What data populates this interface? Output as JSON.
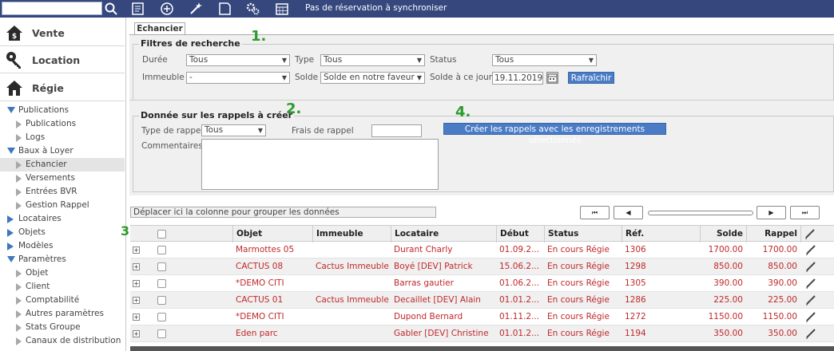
{
  "topbar": {
    "status_text": "Pas de réservation à synchroniser",
    "icons": [
      "search-icon",
      "list-icon",
      "plus-circle-icon",
      "magic-wand-icon",
      "note-icon",
      "gears-icon",
      "calendar-icon"
    ]
  },
  "sidebar": {
    "big_items": [
      {
        "label": "Vente",
        "icon": "house-dollar-icon"
      },
      {
        "label": "Location",
        "icon": "key-icon"
      },
      {
        "label": "Régie",
        "icon": "house-icon"
      }
    ],
    "tree": [
      {
        "label": "Publications",
        "level": 0,
        "expanded": true
      },
      {
        "label": "Publications",
        "level": 1
      },
      {
        "label": "Logs",
        "level": 1
      },
      {
        "label": "Baux à Loyer",
        "level": 0,
        "expanded": true
      },
      {
        "label": "Echancier",
        "level": 1,
        "selected": true
      },
      {
        "label": "Versements",
        "level": 1
      },
      {
        "label": "Entrées BVR",
        "level": 1
      },
      {
        "label": "Gestion Rappel",
        "level": 1
      },
      {
        "label": "Locataires",
        "level": 0,
        "expanded": false
      },
      {
        "label": "Objets",
        "level": 0,
        "expanded": false
      },
      {
        "label": "Modèles",
        "level": 0,
        "expanded": false
      },
      {
        "label": "Paramètres",
        "level": 0,
        "expanded": true
      },
      {
        "label": "Objet",
        "level": 1
      },
      {
        "label": "Client",
        "level": 1
      },
      {
        "label": "Comptabilité",
        "level": 1
      },
      {
        "label": "Autres paramètres",
        "level": 1
      },
      {
        "label": "Stats Groupe",
        "level": 1
      },
      {
        "label": "Canaux de distribution",
        "level": 1
      }
    ]
  },
  "tab": {
    "label": "Echancier"
  },
  "filters": {
    "legend": "Filtres de recherche",
    "marker": "1.",
    "duree_label": "Durée",
    "duree_value": "Tous",
    "type_label": "Type",
    "type_value": "Tous",
    "status_label": "Status",
    "status_value": "Tous",
    "immeuble_label": "Immeuble",
    "immeuble_value": "-",
    "solde_label": "Solde",
    "solde_value": "Solde en notre faveur",
    "solde_date_label": "Solde à ce jour",
    "solde_date_value": "19.11.2019",
    "refresh_label": "Rafraîchir"
  },
  "reminders": {
    "legend": "Donnée sur les rappels à créer",
    "marker": "2.",
    "type_label": "Type de rappel",
    "type_value": "Tous",
    "frais_label": "Frais de rappel",
    "frais_value": "",
    "comments_label": "Commentaires",
    "comments_value": "",
    "create_marker": "4.",
    "create_label": "Créer les rappels avec les enregistrements sélectionnés"
  },
  "grid": {
    "marker": "3.",
    "group_hint": "Déplacer ici la colonne pour grouper les données",
    "pager": {
      "first": "⏮",
      "prev": "◀",
      "next": "▶",
      "last": "⏭"
    },
    "columns": [
      "Objet",
      "Immeuble",
      "Locataire",
      "Début",
      "Status",
      "Réf.",
      "Solde",
      "Rappel"
    ],
    "rows": [
      {
        "objet": "Marmottes 05",
        "immeuble": "",
        "locataire": "Durant Charly",
        "debut": "01.09.2...",
        "status": "En cours Régie",
        "ref": "1306",
        "solde": "1700.00",
        "rappel": "1700.00"
      },
      {
        "objet": "CACTUS 08",
        "immeuble": "Cactus Immeuble",
        "locataire": "Boyé [DEV] Patrick",
        "debut": "15.06.2...",
        "status": "En cours Régie",
        "ref": "1298",
        "solde": "850.00",
        "rappel": "850.00"
      },
      {
        "objet": "*DEMO CITI",
        "immeuble": "",
        "locataire": "Barras gautier",
        "debut": "01.06.2...",
        "status": "En cours Régie",
        "ref": "1305",
        "solde": "390.00",
        "rappel": "390.00"
      },
      {
        "objet": "CACTUS 01",
        "immeuble": "Cactus Immeuble",
        "locataire": "Decaillet [DEV] Alain",
        "debut": "01.01.2...",
        "status": "En cours Régie",
        "ref": "1286",
        "solde": "225.00",
        "rappel": "225.00"
      },
      {
        "objet": "*DEMO CITI",
        "immeuble": "",
        "locataire": "Dupond Bernard",
        "debut": "01.11.2...",
        "status": "En cours Régie",
        "ref": "1272",
        "solde": "1150.00",
        "rappel": "1150.00"
      },
      {
        "objet": "Eden parc",
        "immeuble": "",
        "locataire": "Gabler [DEV] Christine",
        "debut": "01.01.2...",
        "status": "En cours Régie",
        "ref": "1194",
        "solde": "350.00",
        "rappel": "350.00"
      }
    ]
  },
  "colors": {
    "topbar": "#35477d",
    "accent": "#4a7cc6",
    "row_text": "#c0282b",
    "marker": "#2d9a2d"
  }
}
